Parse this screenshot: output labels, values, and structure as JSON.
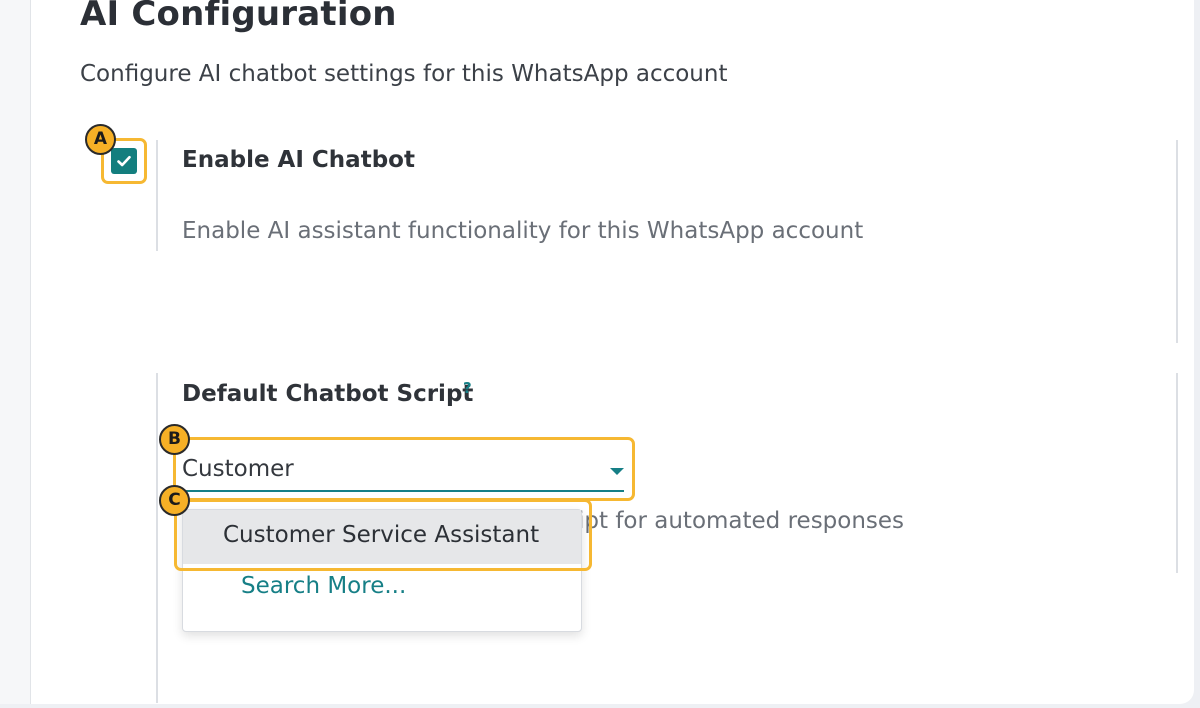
{
  "header": {
    "title": "AI Configuration",
    "subtitle": "Configure AI chatbot settings for this WhatsApp account"
  },
  "enable_ai": {
    "checked": true,
    "label": "Enable AI Chatbot",
    "description": "Enable AI assistant functionality for this WhatsApp account"
  },
  "default_script": {
    "label": "Default Chatbot Script",
    "help_mark": "?",
    "input_value": "Customer",
    "description_visible": "ipt for automated responses",
    "dropdown": {
      "options": [
        "Customer Service Assistant"
      ],
      "search_more": "Search More..."
    }
  },
  "annotations": {
    "badges": [
      "A",
      "B",
      "C"
    ],
    "highlight_color": "#f6b832"
  },
  "colors": {
    "accent": "#167f86",
    "checkbox": "#137e7e",
    "badge": "#f6b026"
  }
}
